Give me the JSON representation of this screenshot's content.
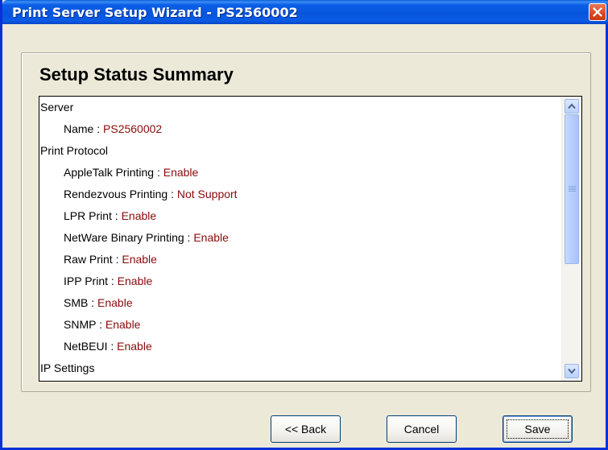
{
  "window": {
    "title": "Print Server Setup Wizard - PS2560002"
  },
  "panel": {
    "heading": "Setup Status Summary"
  },
  "summary_rows": [
    {
      "label": "Server",
      "value": "",
      "indent": 0
    },
    {
      "label": "Name : ",
      "value": "PS2560002",
      "indent": 1
    },
    {
      "label": "Print Protocol",
      "value": "",
      "indent": 0
    },
    {
      "label": "AppleTalk Printing : ",
      "value": "Enable",
      "indent": 1
    },
    {
      "label": "Rendezvous Printing : ",
      "value": "Not Support",
      "indent": 1
    },
    {
      "label": "LPR Print : ",
      "value": "Enable",
      "indent": 1
    },
    {
      "label": "NetWare Binary Printing : ",
      "value": "Enable",
      "indent": 1
    },
    {
      "label": "Raw Print : ",
      "value": "Enable",
      "indent": 1
    },
    {
      "label": "IPP Print : ",
      "value": "Enable",
      "indent": 1
    },
    {
      "label": "SMB : ",
      "value": "Enable",
      "indent": 1
    },
    {
      "label": "SNMP : ",
      "value": "Enable",
      "indent": 1
    },
    {
      "label": "NetBEUI : ",
      "value": "Enable",
      "indent": 1
    },
    {
      "label": "IP Settings",
      "value": "",
      "indent": 0
    }
  ],
  "scrollbar": {
    "up_icon": "triangle-up-icon",
    "down_icon": "triangle-down-icon",
    "position_fraction": 0.0
  },
  "buttons": {
    "back": "<< Back",
    "cancel": "Cancel",
    "save": "Save"
  },
  "colors": {
    "title_bar": "#0855dd",
    "value_text": "#8b0a0a",
    "close_button": "#d84a22",
    "dialog_bg": "#ece9d8"
  }
}
